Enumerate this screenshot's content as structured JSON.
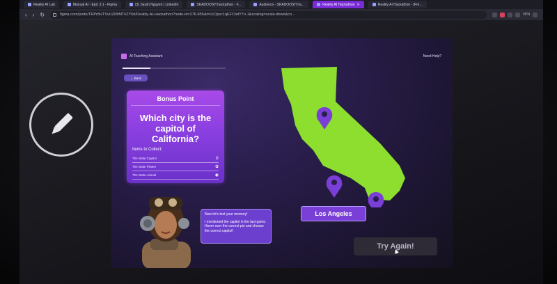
{
  "browser": {
    "tabs": [
      {
        "label": "Reality AI Lab",
        "active": false
      },
      {
        "label": "Manual AI - Epic 3.1 - Figma",
        "active": false
      },
      {
        "label": "(3) Sarah Nguyen | LinkedIn",
        "active": false
      },
      {
        "label": "SKADOOSH hackathon - F...",
        "active": false
      },
      {
        "label": "Audience - SKADOOSH ha...",
        "active": false
      },
      {
        "label": "Reality AI Hackathon",
        "active": true
      },
      {
        "label": "Reality AI Hackathon - [Fre...",
        "active": false
      }
    ],
    "nav": {
      "back": "‹",
      "forward": "›",
      "reload": "↻"
    },
    "url": "figma.com/proto/TRPr8HTSvUZiWMTkZY6rt/Reality-AI-Hackathon?node-id=276-855&t=UL0psc1qEFCbdY7n-1&scaling=scale-down&co...",
    "vpn_label": "VPN"
  },
  "app": {
    "brand": "AI Teaching Assistant",
    "help_link": "Need Help?",
    "progress_fraction": 0.27,
    "back_label": "Back",
    "card": {
      "title": "Bonus Point",
      "question": "Which city is the capitol of California?",
      "collect_label": "Items to Collect:",
      "items": [
        {
          "label": "The State Capitol",
          "icon": "pin-icon"
        },
        {
          "label": "The State Flower",
          "icon": "flower-icon"
        },
        {
          "label": "The State Animal",
          "icon": "paw-icon"
        }
      ]
    },
    "map": {
      "region": "California",
      "pins": [
        "north",
        "central",
        "south"
      ]
    },
    "answer_label": "Los Angeles",
    "speech": {
      "line1": "Now let's test your memory!",
      "line2": "I mentioned the capitol in the last game. Hover over the correct pin and choose the correct capitol!"
    },
    "try_again_label": "Try Again!"
  },
  "colors": {
    "accent_purple": "#8a3fe0",
    "map_green": "#8dde2e",
    "pin_purple": "#7a3fd6",
    "active_tab": "#7a2bd8"
  }
}
